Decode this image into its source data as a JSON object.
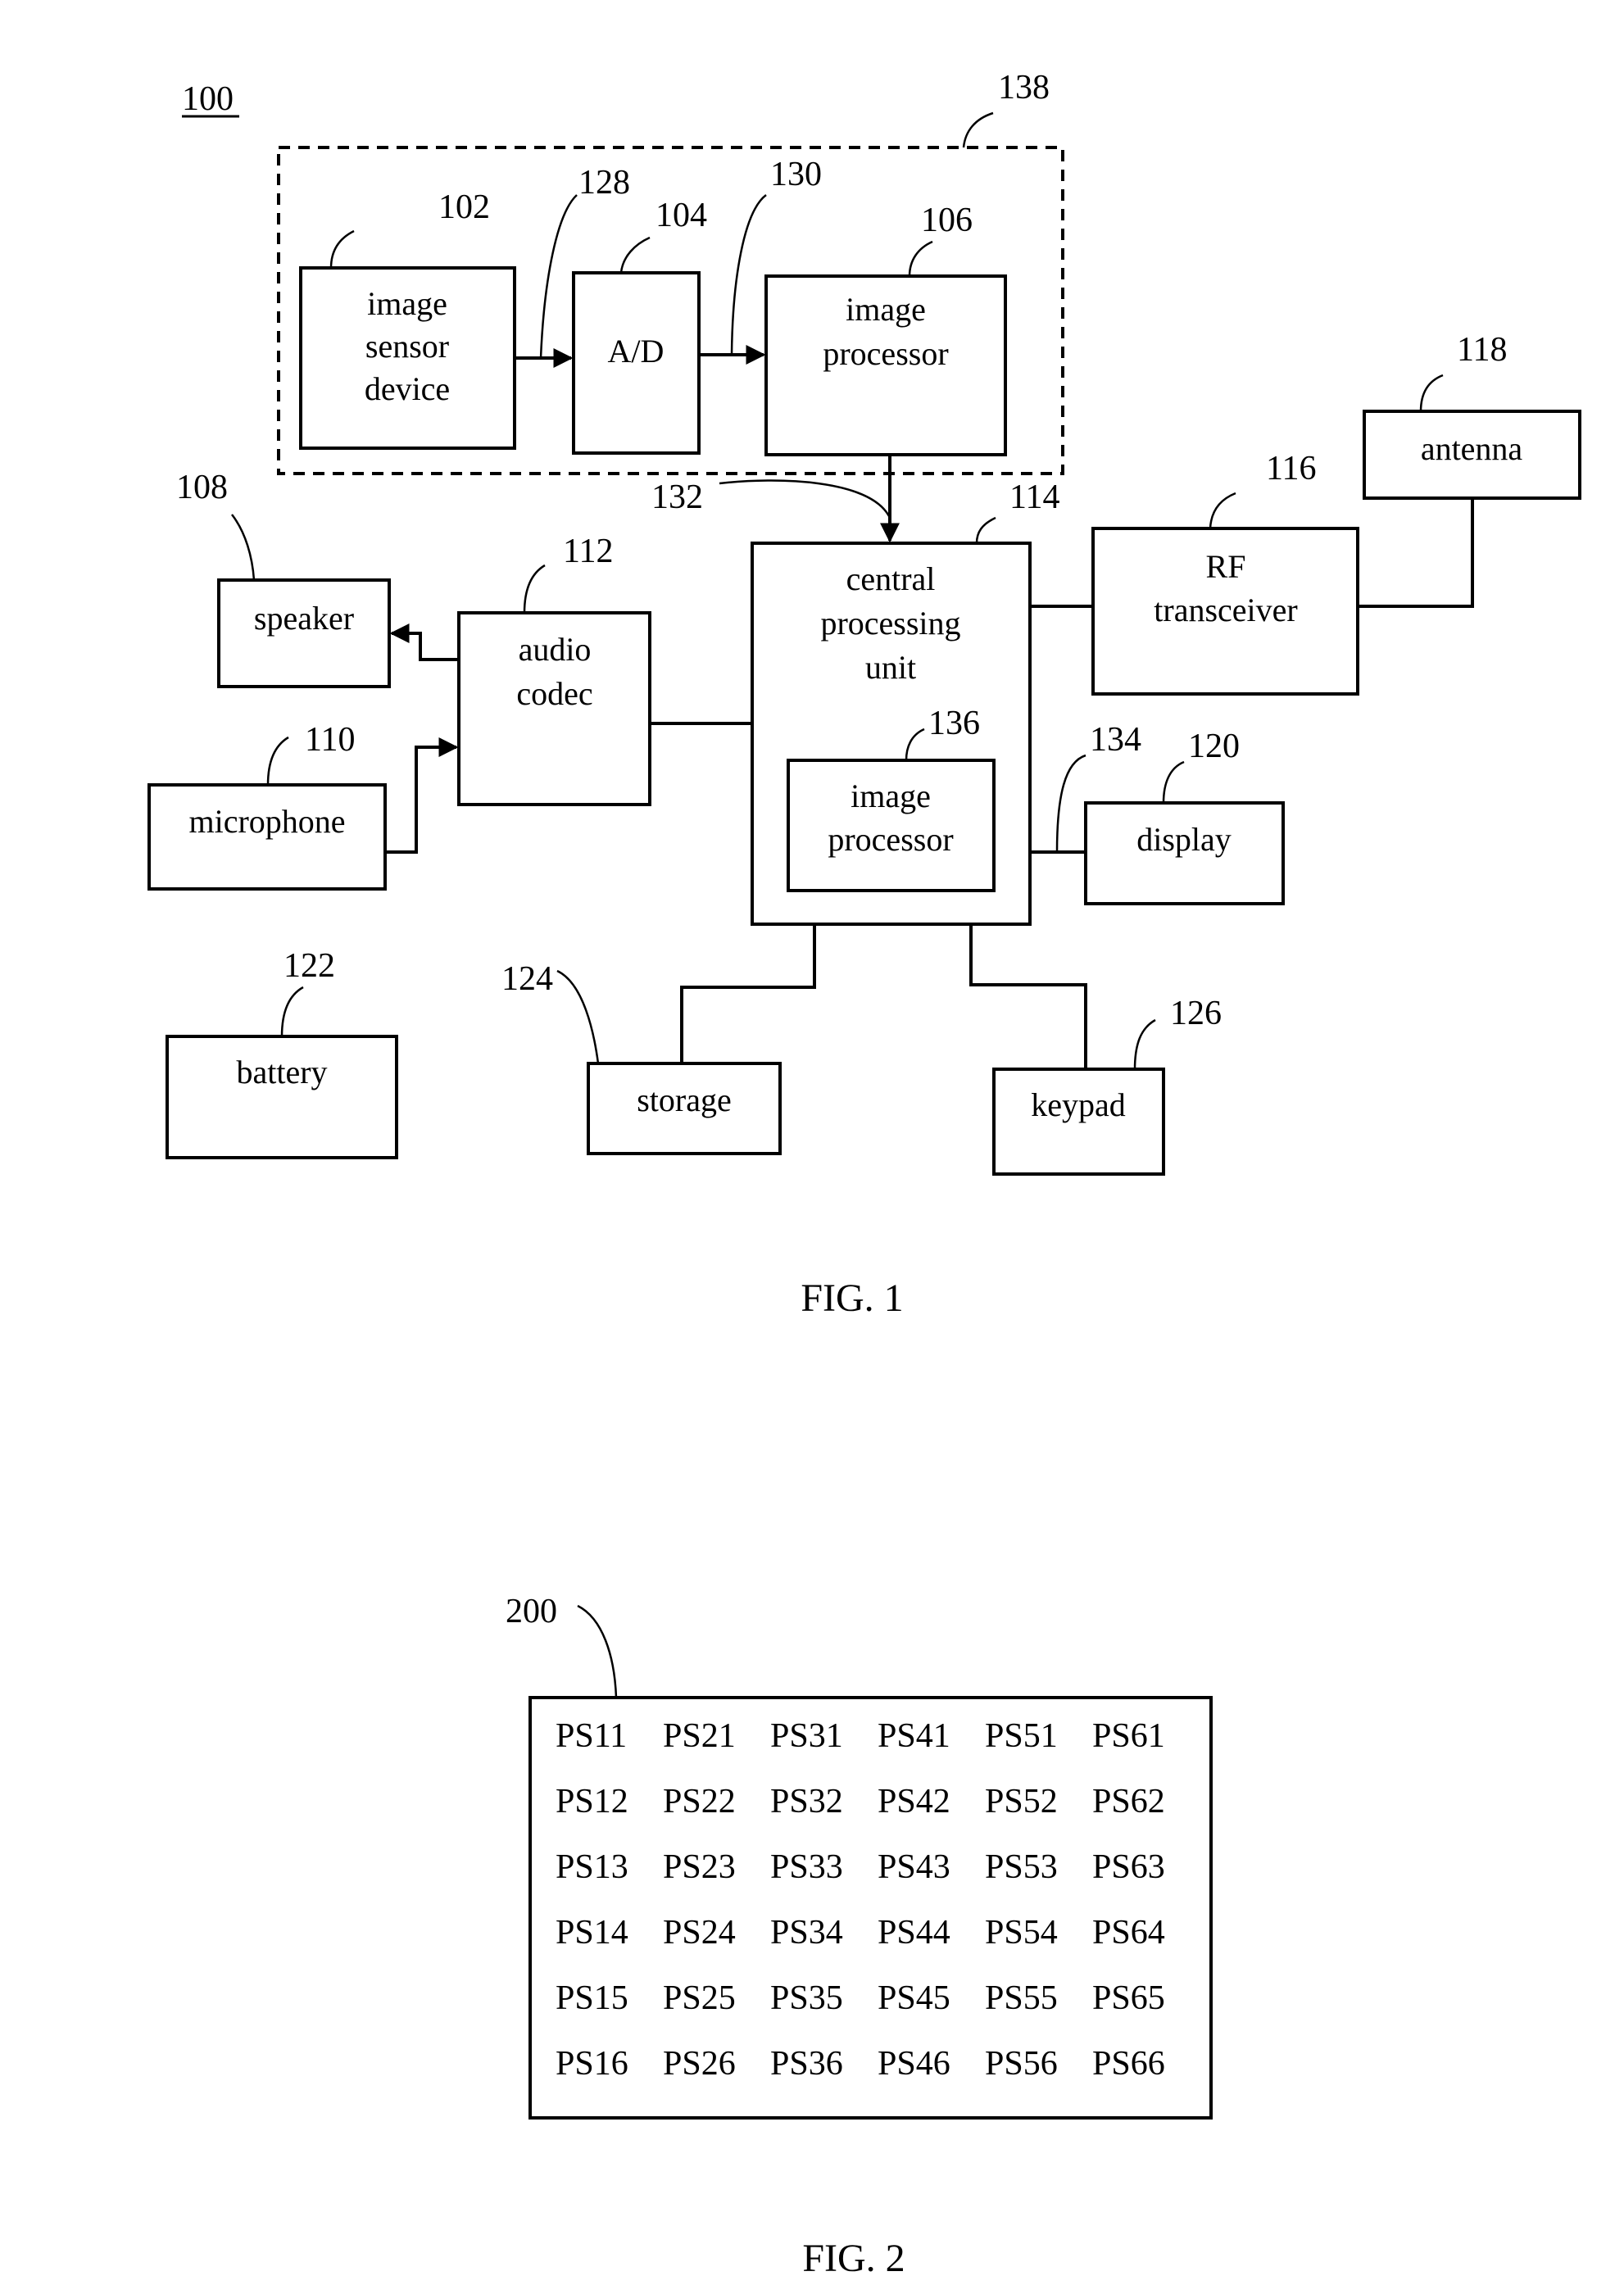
{
  "figure1": {
    "system_ref": "100",
    "caption": "FIG. 1",
    "group_ref": "138",
    "blocks": {
      "image_sensor": {
        "ref": "102",
        "lines": [
          "image",
          "sensor",
          "device"
        ]
      },
      "ad": {
        "ref": "104",
        "lines": [
          "A/D"
        ]
      },
      "image_processor": {
        "ref": "106",
        "lines": [
          "image",
          "processor"
        ]
      },
      "speaker": {
        "ref": "108",
        "lines": [
          "speaker"
        ]
      },
      "microphone": {
        "ref": "110",
        "lines": [
          "microphone"
        ]
      },
      "audio_codec": {
        "ref": "112",
        "lines": [
          "audio",
          "codec"
        ]
      },
      "cpu": {
        "ref": "114",
        "lines": [
          "central",
          "processing",
          "unit"
        ]
      },
      "rf_transceiver": {
        "ref": "116",
        "lines": [
          "RF",
          "transceiver"
        ]
      },
      "antenna": {
        "ref": "118",
        "lines": [
          "antenna"
        ]
      },
      "display": {
        "ref": "120",
        "lines": [
          "display"
        ]
      },
      "battery": {
        "ref": "122",
        "lines": [
          "battery"
        ]
      },
      "storage": {
        "ref": "124",
        "lines": [
          "storage"
        ]
      },
      "keypad": {
        "ref": "126",
        "lines": [
          "keypad"
        ]
      },
      "cpu_image_processor": {
        "ref": "136",
        "lines": [
          "image",
          "processor"
        ]
      }
    },
    "signals": {
      "sensor_to_ad": "128",
      "ad_to_processor": "130",
      "processor_to_cpu": "132",
      "cpu_to_display": "134"
    }
  },
  "figure2": {
    "ref": "200",
    "caption": "FIG. 2",
    "grid": [
      [
        "PS11",
        "PS21",
        "PS31",
        "PS41",
        "PS51",
        "PS61"
      ],
      [
        "PS12",
        "PS22",
        "PS32",
        "PS42",
        "PS52",
        "PS62"
      ],
      [
        "PS13",
        "PS23",
        "PS33",
        "PS43",
        "PS53",
        "PS63"
      ],
      [
        "PS14",
        "PS24",
        "PS34",
        "PS44",
        "PS54",
        "PS64"
      ],
      [
        "PS15",
        "PS25",
        "PS35",
        "PS45",
        "PS55",
        "PS65"
      ],
      [
        "PS16",
        "PS26",
        "PS36",
        "PS46",
        "PS56",
        "PS66"
      ]
    ]
  }
}
